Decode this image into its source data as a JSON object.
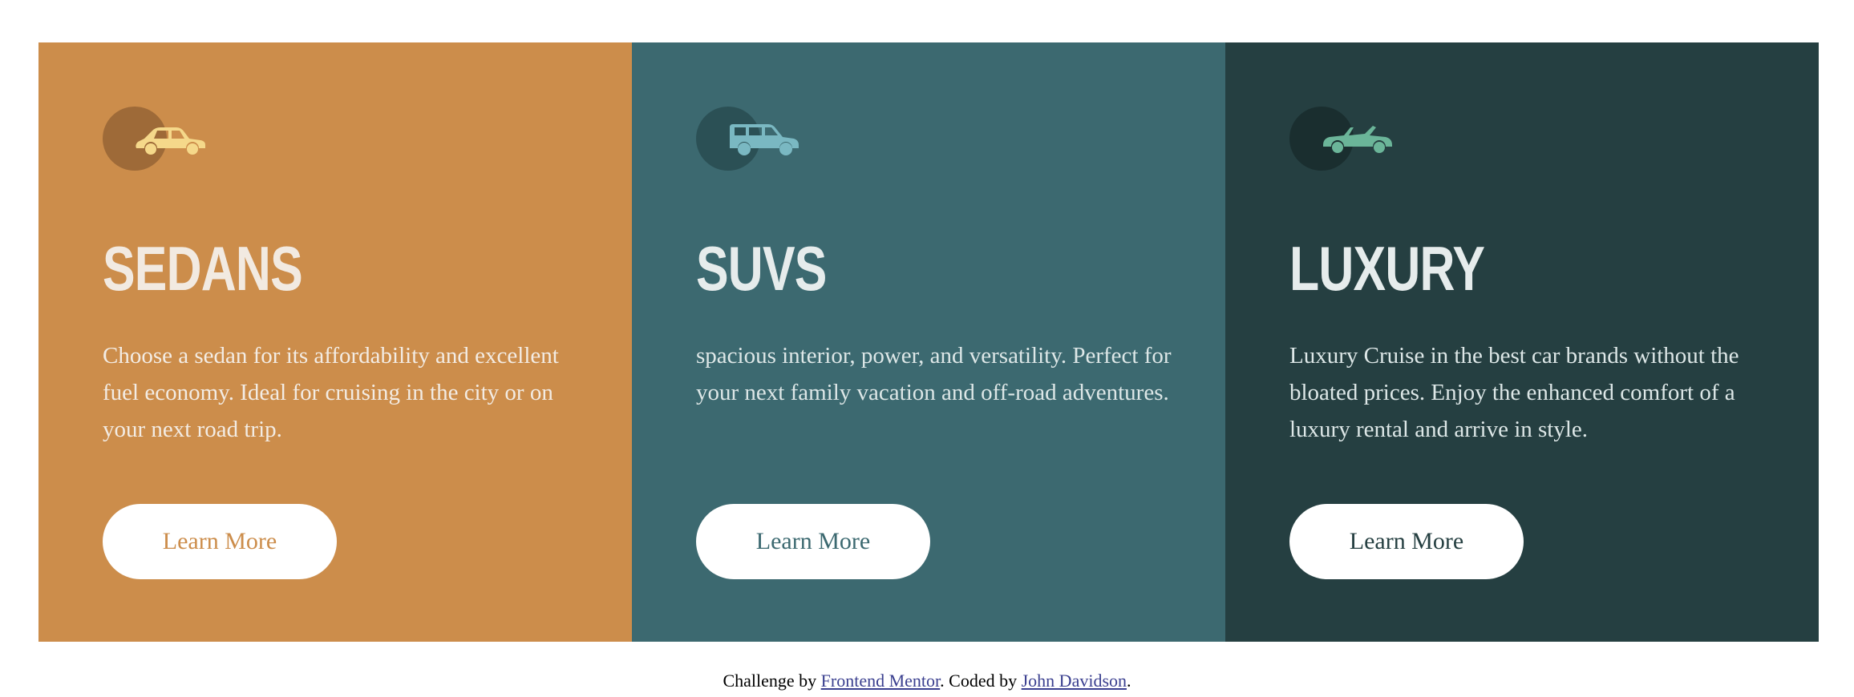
{
  "cards": [
    {
      "key": "sedans",
      "icon": "sedan-car-icon",
      "title": "SEDANS",
      "description": "Choose a sedan for its affordability and excellent fuel economy. Ideal for cruising in the city or on your next road trip.",
      "button_label": "Learn More",
      "color": "#cc8d4b",
      "icon_color": "#f5d88a"
    },
    {
      "key": "suvs",
      "icon": "suv-car-icon",
      "title": "SUVS",
      "description": "spacious interior, power, and versatility. Perfect for your next family vacation and off-road adventures.",
      "button_label": "Learn More",
      "color": "#3c6970",
      "icon_color": "#7ab8c2"
    },
    {
      "key": "luxury",
      "icon": "luxury-convertible-icon",
      "title": "LUXURY",
      "description": "Luxury Cruise in the best car brands without the bloated prices. Enjoy the enhanced comfort of a luxury rental and arrive in style.",
      "button_label": "Learn More",
      "color": "#253f41",
      "icon_color": "#6bb599"
    }
  ],
  "footer": {
    "prefix": "Challenge by ",
    "link1": "Frontend Mentor",
    "middle": ". Coded by ",
    "link2": "John Davidson",
    "suffix": "."
  }
}
